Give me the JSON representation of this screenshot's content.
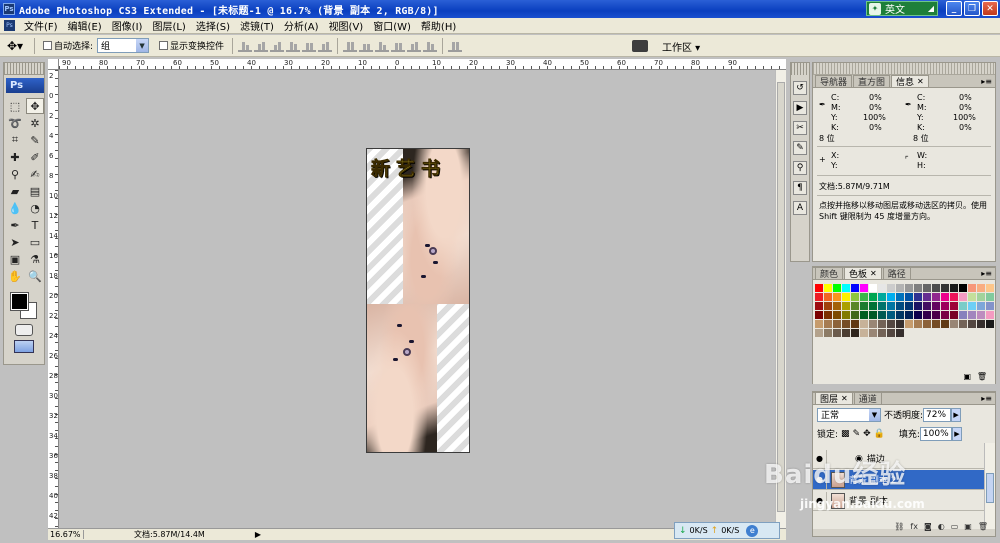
{
  "window": {
    "title": "Adobe Photoshop CS3 Extended - [未标题-1 @ 16.7% (背景 副本 2, RGB/8)]",
    "ime_label": "英文",
    "app_badge": "Ps"
  },
  "menu": [
    "文件(F)",
    "编辑(E)",
    "图像(I)",
    "图层(L)",
    "选择(S)",
    "滤镜(T)",
    "分析(A)",
    "视图(V)",
    "窗口(W)",
    "帮助(H)"
  ],
  "options": {
    "auto_select_label": "自动选择:",
    "auto_select_value": "组",
    "show_transform_label": "显示变换控件",
    "workspace_label": "工作区 ▾"
  },
  "rulers": {
    "h_ticks": [
      "90",
      "80",
      "70",
      "60",
      "50",
      "40",
      "30",
      "20",
      "10",
      "0",
      "10",
      "20",
      "30",
      "40",
      "50",
      "60",
      "70",
      "80",
      "90"
    ],
    "v_ticks": [
      "2",
      "0",
      "2",
      "4",
      "6",
      "8",
      "10",
      "12",
      "14",
      "16",
      "18",
      "20",
      "22",
      "24",
      "26",
      "28",
      "30",
      "32",
      "34",
      "36",
      "38",
      "40",
      "42"
    ]
  },
  "document": {
    "title_text": "新艺书"
  },
  "status": {
    "zoom": "16.67%",
    "doc_info": "文档:5.87M/14.4M"
  },
  "info_panel": {
    "tabs": [
      "导航器",
      "直方图",
      "信息"
    ],
    "left": {
      "C": "0%",
      "M": "0%",
      "Y": "100%",
      "K": "0%",
      "bits": "8 位"
    },
    "right": {
      "C": "0%",
      "M": "0%",
      "Y": "100%",
      "K": "0%",
      "bits": "8 位"
    },
    "x_label": "X:",
    "y_label": "Y:",
    "w_label": "W:",
    "h_label": "H:",
    "doc_size": "文档:5.87M/9.71M",
    "hint": "点按并拖移以移动图层或移动选区的拷贝。使用 Shift 键限制为 45 度增量方向。"
  },
  "swatch_panel": {
    "tabs": [
      "颜色",
      "色板",
      "路径"
    ]
  },
  "layers_panel": {
    "tabs": [
      "图层",
      "通道"
    ],
    "blend_mode": "正常",
    "opacity_label": "不透明度:",
    "opacity_value": "72%",
    "lock_label": "锁定:",
    "fill_label": "填充:",
    "fill_value": "100%",
    "layers": [
      {
        "name": "描边",
        "selected": false
      },
      {
        "name": "背景 副本 2",
        "selected": true
      },
      {
        "name": "背景 副本",
        "selected": false
      }
    ]
  },
  "netspeed": {
    "down": "0K/S",
    "up": "0K/S"
  },
  "watermark": {
    "main": "Baidu经验",
    "sub": "jingyan.baidu.com"
  },
  "icons": [
    "move-tool-icon",
    "marquee-icon",
    "lasso-icon",
    "crop-icon",
    "brush-icon",
    "eraser-icon",
    "text-icon",
    "hand-icon",
    "zoom-icon"
  ]
}
